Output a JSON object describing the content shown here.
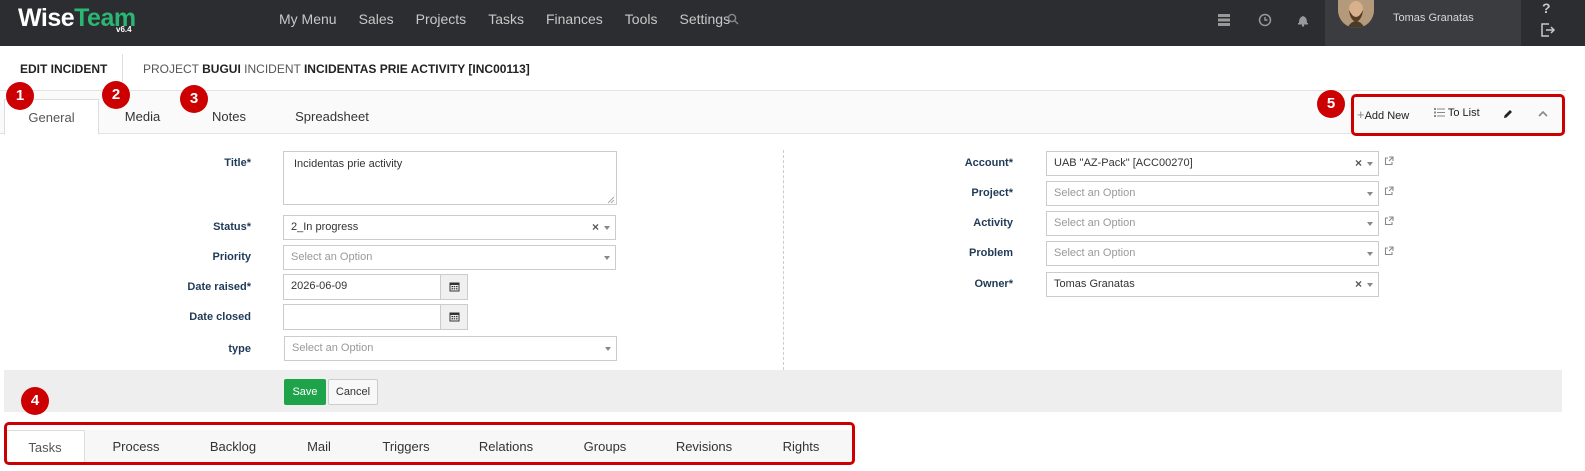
{
  "brand": {
    "name_part1": "Wise",
    "name_part2": "Team",
    "version": "v6.4"
  },
  "nav": {
    "menu": [
      "My Menu",
      "Sales",
      "Projects",
      "Tasks",
      "Finances",
      "Tools",
      "Settings"
    ],
    "user_name": "Tomas Granatas",
    "help_label": "?"
  },
  "header": {
    "edit_title": "EDIT INCIDENT",
    "crumbs": [
      {
        "label": "PROJECT",
        "value": "BUGUI"
      },
      {
        "label": "INCIDENT",
        "value": "INCIDENTAS PRIE ACTIVITY [INC00113]"
      }
    ]
  },
  "tabs": [
    "General",
    "Media",
    "Notes",
    "Spreadsheet"
  ],
  "toolbar": {
    "add_new": "Add New",
    "to_list": "To List"
  },
  "annotations": [
    "1",
    "2",
    "3",
    "4",
    "5"
  ],
  "form_left": {
    "title": {
      "label": "Title*",
      "value": "Incidentas prie activity"
    },
    "status": {
      "label": "Status*",
      "value": "2_In progress"
    },
    "priority": {
      "label": "Priority",
      "placeholder": "Select an Option"
    },
    "date_raised": {
      "label": "Date raised*",
      "value": "2026-06-09"
    },
    "date_closed": {
      "label": "Date closed",
      "value": ""
    },
    "type": {
      "label": "type",
      "placeholder": "Select an Option"
    }
  },
  "form_right": {
    "account": {
      "label": "Account*",
      "value": "UAB \"AZ-Pack\" [ACC00270]"
    },
    "project": {
      "label": "Project*",
      "placeholder": "Select an Option"
    },
    "activity": {
      "label": "Activity",
      "placeholder": "Select an Option"
    },
    "problem": {
      "label": "Problem",
      "placeholder": "Select an Option"
    },
    "owner": {
      "label": "Owner*",
      "value": "Tomas Granatas"
    }
  },
  "buttons": {
    "save": "Save",
    "cancel": "Cancel"
  },
  "bottom_tabs": [
    "Tasks",
    "Process",
    "Backlog",
    "Mail",
    "Triggers",
    "Relations",
    "Groups",
    "Revisions",
    "Rights"
  ],
  "colors": {
    "navbar": "#2b2d30",
    "brand_accent": "#2ab673",
    "annotation": "#cc0000",
    "save": "#1fa34a"
  }
}
